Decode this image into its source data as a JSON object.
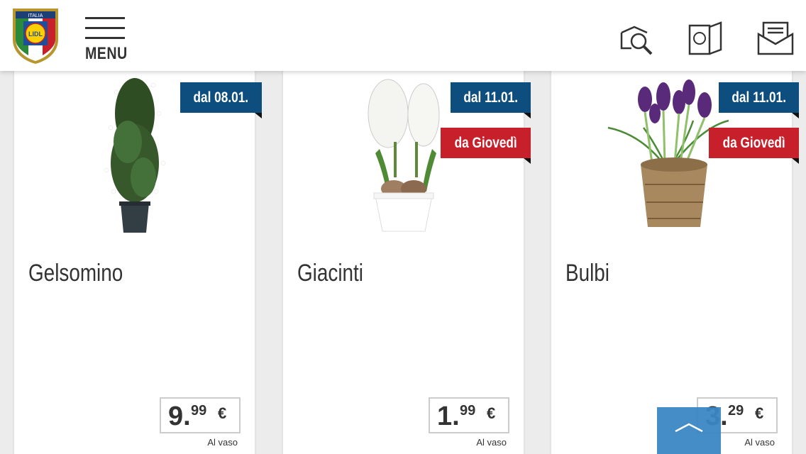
{
  "header": {
    "logo": {
      "country": "ITALIA",
      "brand": "LIDL"
    },
    "menu_label": "MENU",
    "icons": [
      "search-flyer-icon",
      "leaflet-icon",
      "newsletter-icon"
    ]
  },
  "products": [
    {
      "name": "Gelsomino",
      "badge_date": "dal 08.01.",
      "badge_day": "",
      "price_int": "9.",
      "price_dec": "99",
      "currency": "€",
      "unit": "Al vaso"
    },
    {
      "name": "Giacinti",
      "badge_date": "dal 11.01.",
      "badge_day": "da Giovedì",
      "price_int": "1.",
      "price_dec": "99",
      "currency": "€",
      "unit": "Al vaso"
    },
    {
      "name": "Bulbi",
      "badge_date": "dal 11.01.",
      "badge_day": "da Giovedì",
      "price_int": "3.",
      "price_dec": "29",
      "currency": "€",
      "unit": "Al vaso"
    }
  ],
  "colors": {
    "badge_date": "#0d4e7f",
    "badge_day": "#c8202a",
    "scroll_top": "#3a87c4"
  }
}
